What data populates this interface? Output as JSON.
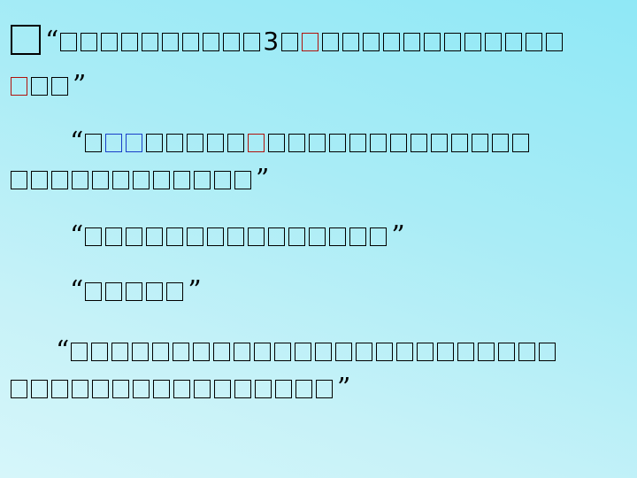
{
  "paragraph_1": {
    "open_quote": "“",
    "close_quote": "”",
    "number": "3"
  },
  "paragraph_2": {
    "open_quote": "“",
    "close_quote": "”"
  },
  "paragraph_3": {
    "open_quote": "“",
    "close_quote": "”"
  },
  "paragraph_4": {
    "open_quote": "“",
    "close_quote": "”"
  },
  "paragraph_5": {
    "open_quote": "“",
    "close_quote": "”"
  },
  "colors": {
    "text": "#000000",
    "highlight_red": "#b0120c",
    "highlight_blue": "#1a3ec8"
  }
}
